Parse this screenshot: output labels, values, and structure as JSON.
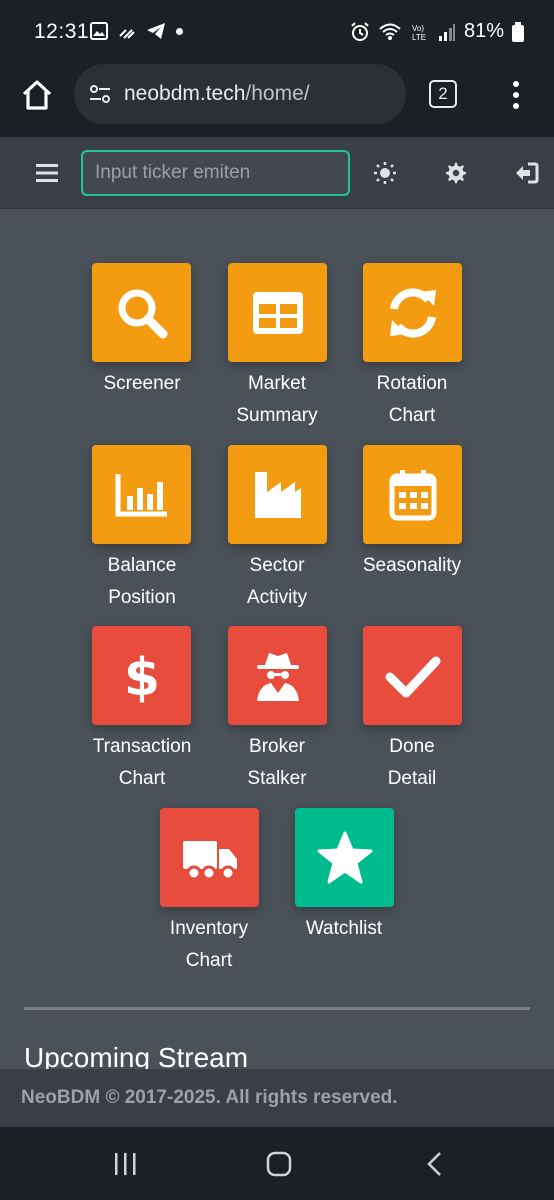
{
  "status": {
    "time": "12:31",
    "battery": "81%"
  },
  "browser": {
    "url_host": "neobdm.tech",
    "url_path": "/home/",
    "tab_count": "2"
  },
  "header": {
    "ticker_placeholder": "Input ticker emiten"
  },
  "menu": [
    {
      "label": "Screener",
      "icon": "search-icon",
      "color": "#f39c12"
    },
    {
      "label": "Market Summary",
      "icon": "table-icon",
      "color": "#f39c12"
    },
    {
      "label": "Rotation Chart",
      "icon": "sync-icon",
      "color": "#f39c12"
    },
    {
      "label": "Balance Position",
      "icon": "bar-chart-icon",
      "color": "#f39c12"
    },
    {
      "label": "Sector Activity",
      "icon": "industry-icon",
      "color": "#f39c12"
    },
    {
      "label": "Seasonality",
      "icon": "calendar-icon",
      "color": "#f39c12"
    },
    {
      "label": "Transaction Chart",
      "icon": "dollar-icon",
      "color": "#e74c3c"
    },
    {
      "label": "Broker Stalker",
      "icon": "spy-icon",
      "color": "#e74c3c"
    },
    {
      "label": "Done Detail",
      "icon": "check-icon",
      "color": "#e74c3c"
    },
    {
      "label": "Inventory Chart",
      "icon": "truck-icon",
      "color": "#e74c3c"
    },
    {
      "label": "Watchlist",
      "icon": "star-icon",
      "color": "#00bc8c"
    }
  ],
  "section": {
    "title": "Upcoming Stream"
  },
  "footer": {
    "text": "NeoBDM © 2017-2025. All rights reserved."
  }
}
